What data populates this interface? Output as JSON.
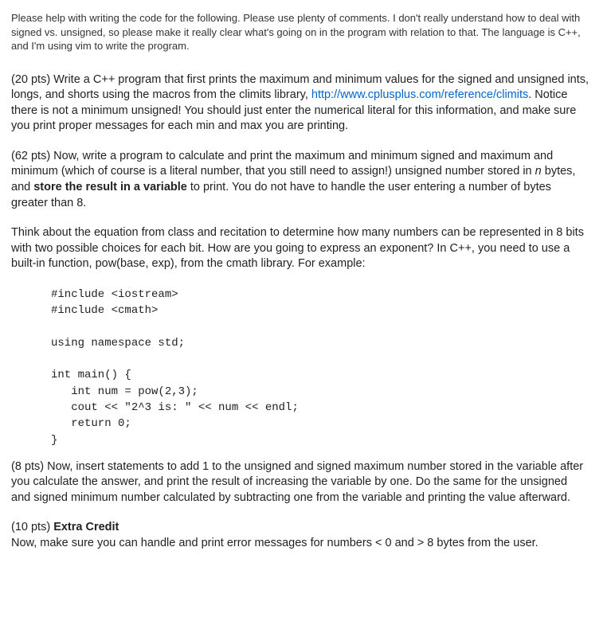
{
  "intro": "Please help with writing the code for the following. Please use plenty of comments. I don't really understand how to deal with signed vs. unsigned, so please make it really clear what's going on in the program with relation to that. The language is C++, and I'm using vim to write the program.",
  "part1": {
    "lead": "(20 pts) Write a C++ program that first prints the maximum and minimum values for the signed and unsigned ints, longs, and shorts using the macros from the climits library, ",
    "link": "http://www.cplusplus.com/reference/climits",
    "after_link": ".  Notice there is not a minimum unsigned! You should just enter the numerical literal for this information, and make sure you print proper messages for each min and max you are printing."
  },
  "part2": {
    "a": "(62 pts) Now, write a program to calculate and print the maximum and minimum signed and maximum and minimum (which of course is a literal number, that you still need to assign!) unsigned number stored in ",
    "n": "n",
    "b": " bytes, and ",
    "bold": "store the result in a variable",
    "c": " to print. You do not have to handle the user entering a number of bytes greater than 8."
  },
  "part3": "Think about the equation from class and recitation to determine how many numbers can be represented in 8 bits with two possible choices for each bit.  How are you going to express an exponent?  In C++, you need to use a built-in function, pow(base, exp), from the cmath library.  For example:",
  "code": "#include <iostream>\n#include <cmath>\n\nusing namespace std;\n\nint main() {\n   int num = pow(2,3);\n   cout << \"2^3 is: \" << num << endl;\n   return 0;\n}",
  "part4": "(8 pts) Now, insert statements to add 1 to the unsigned and signed maximum number stored in the variable after you calculate the answer, and print the result of increasing the variable by one.  Do the same for the unsigned and signed minimum number calculated by subtracting one from the variable and printing the value afterward.",
  "part5": {
    "a": "(10 pts) ",
    "bold": "Extra Credit",
    "b": "Now, make sure you can handle and print error messages for numbers < 0 and > 8 bytes from the user."
  }
}
